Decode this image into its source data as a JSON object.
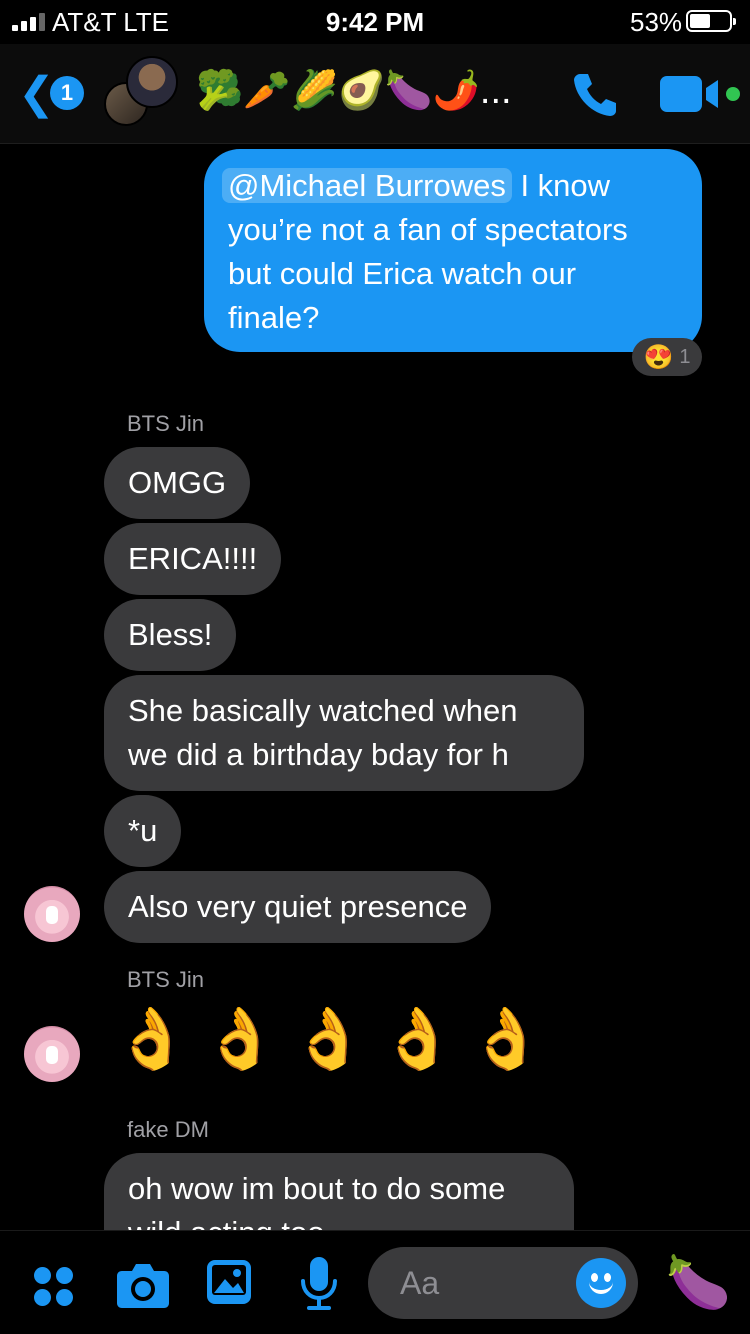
{
  "status_bar": {
    "carrier": "AT&T   LTE",
    "time": "9:42 PM",
    "battery": "53%",
    "battery_level": 0.53
  },
  "header": {
    "back_icon": "chevron-left-icon",
    "unread_count": "1",
    "title": "🥦🥕🌽🥑🍆🌶️...",
    "call_icon": "phone-icon",
    "video_icon": "video-camera-icon",
    "accent_color": "#1b96f3"
  },
  "messages": {
    "outgoing": {
      "mention": "@Michael Burrowes",
      "line1_rest": " I know",
      "line2": "you’re not a fan of spectators",
      "line3": "but could Erica watch our",
      "line4": "finale?",
      "reaction_emoji": "😍",
      "reaction_count": "1"
    },
    "group1_sender": "BTS Jin",
    "m1": "OMGG",
    "m2": "ERICA!!!!",
    "m3": "Bless!",
    "m4_line1": "She basically watched when",
    "m4_line2": "we did a birthday bday for h",
    "m5": "*u",
    "m6": "Also very quiet presence",
    "group2_sender": "BTS Jin",
    "ok_emojis": "👌👌👌👌👌",
    "group3_sender": "fake DM",
    "m7_line1": "oh wow im bout to do some",
    "m7_line2": "wild acting too"
  },
  "composer": {
    "placeholder": "Aa",
    "quick_reaction": "🍆",
    "icons": [
      "menu-dots-icon",
      "camera-icon",
      "photo-icon",
      "microphone-icon",
      "emoji-icon"
    ]
  }
}
